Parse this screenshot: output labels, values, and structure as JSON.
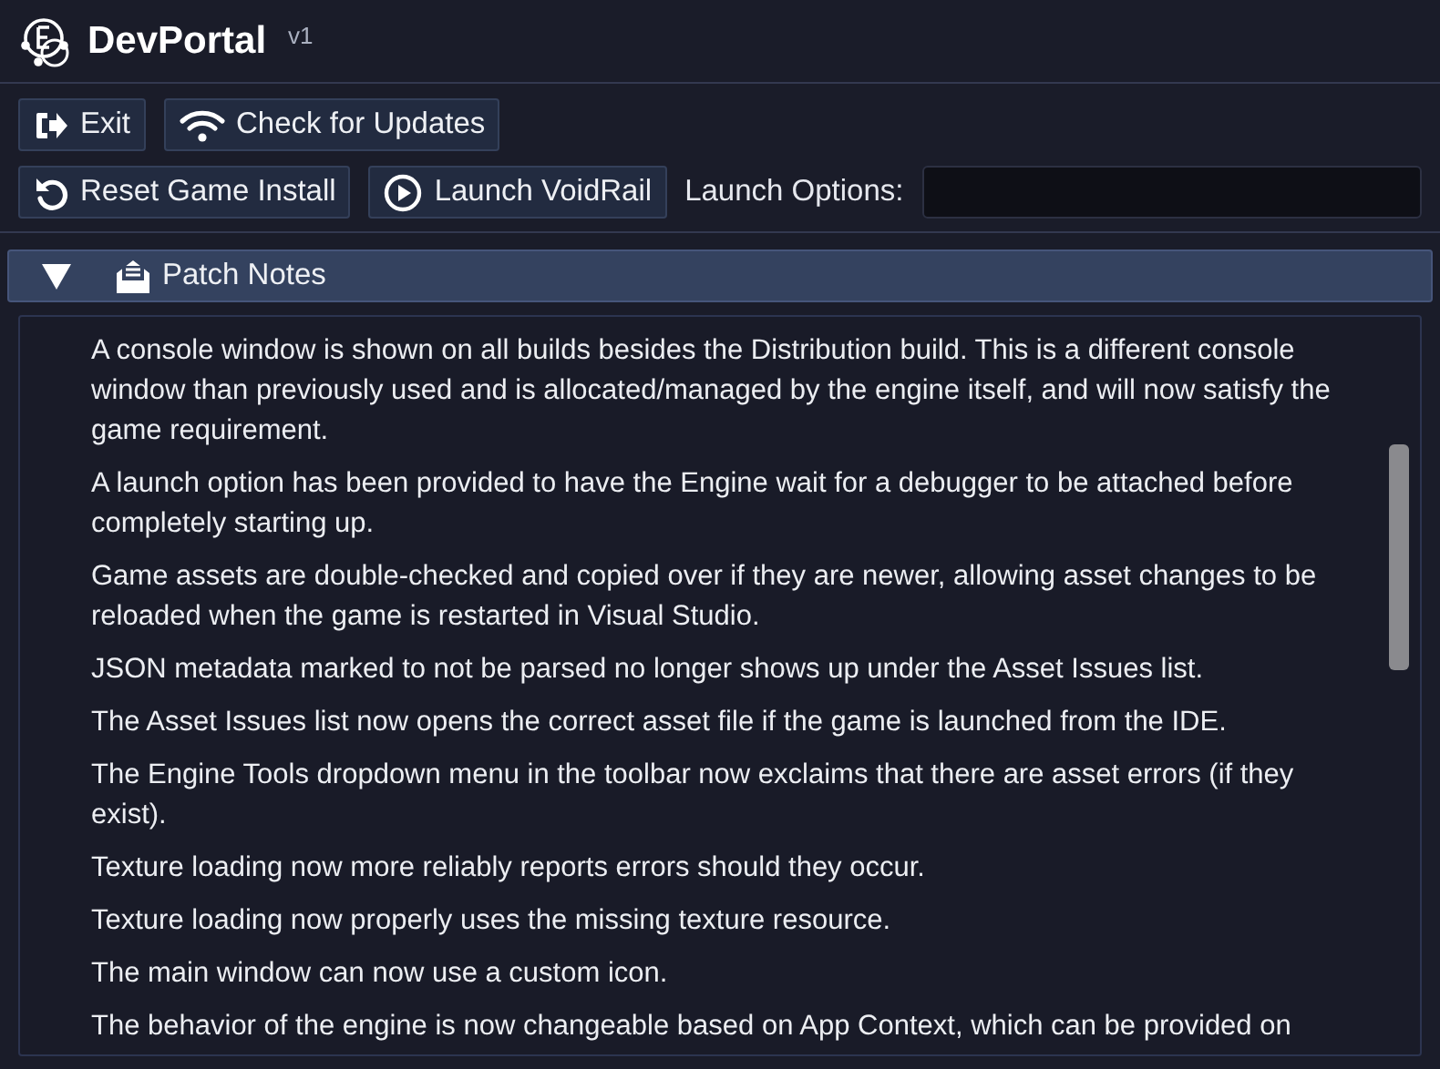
{
  "app": {
    "title": "DevPortal",
    "version": "v1"
  },
  "toolbar_rows": [
    [
      {
        "label": "Exit"
      },
      {
        "label": "Check for Updates"
      }
    ],
    [
      {
        "label": "Reset Game Install"
      },
      {
        "label": "Launch VoidRail"
      }
    ]
  ],
  "launch_options": {
    "label": "Launch Options:"
  },
  "patch_notes": {
    "title": "Patch Notes",
    "expanded": true,
    "paragraphs": [
      "A console window is shown on all builds besides the Distribution build. This is a different console window than previously used and is allocated/managed by the engine itself, and will now satisfy the game requirement.",
      "A launch option has been provided to have the Engine wait for a debugger to be attached before completely starting up.",
      "Game assets are double-checked and copied over if they are newer, allowing asset changes to be reloaded when the game is restarted in Visual Studio.",
      "JSON metadata marked to not be parsed no longer shows up under the Asset Issues list.",
      "The Asset Issues list now opens the correct asset file if the game is launched from the IDE.",
      "The Engine Tools dropdown menu in the toolbar now exclaims that there are asset errors (if they exist).",
      "Texture loading now more reliably reports errors should they occur.",
      "Texture loading now properly uses the missing texture resource.",
      "The main window can now use a custom icon.",
      "The behavior of the engine is now changeable based on App Context, which can be provided on"
    ]
  }
}
